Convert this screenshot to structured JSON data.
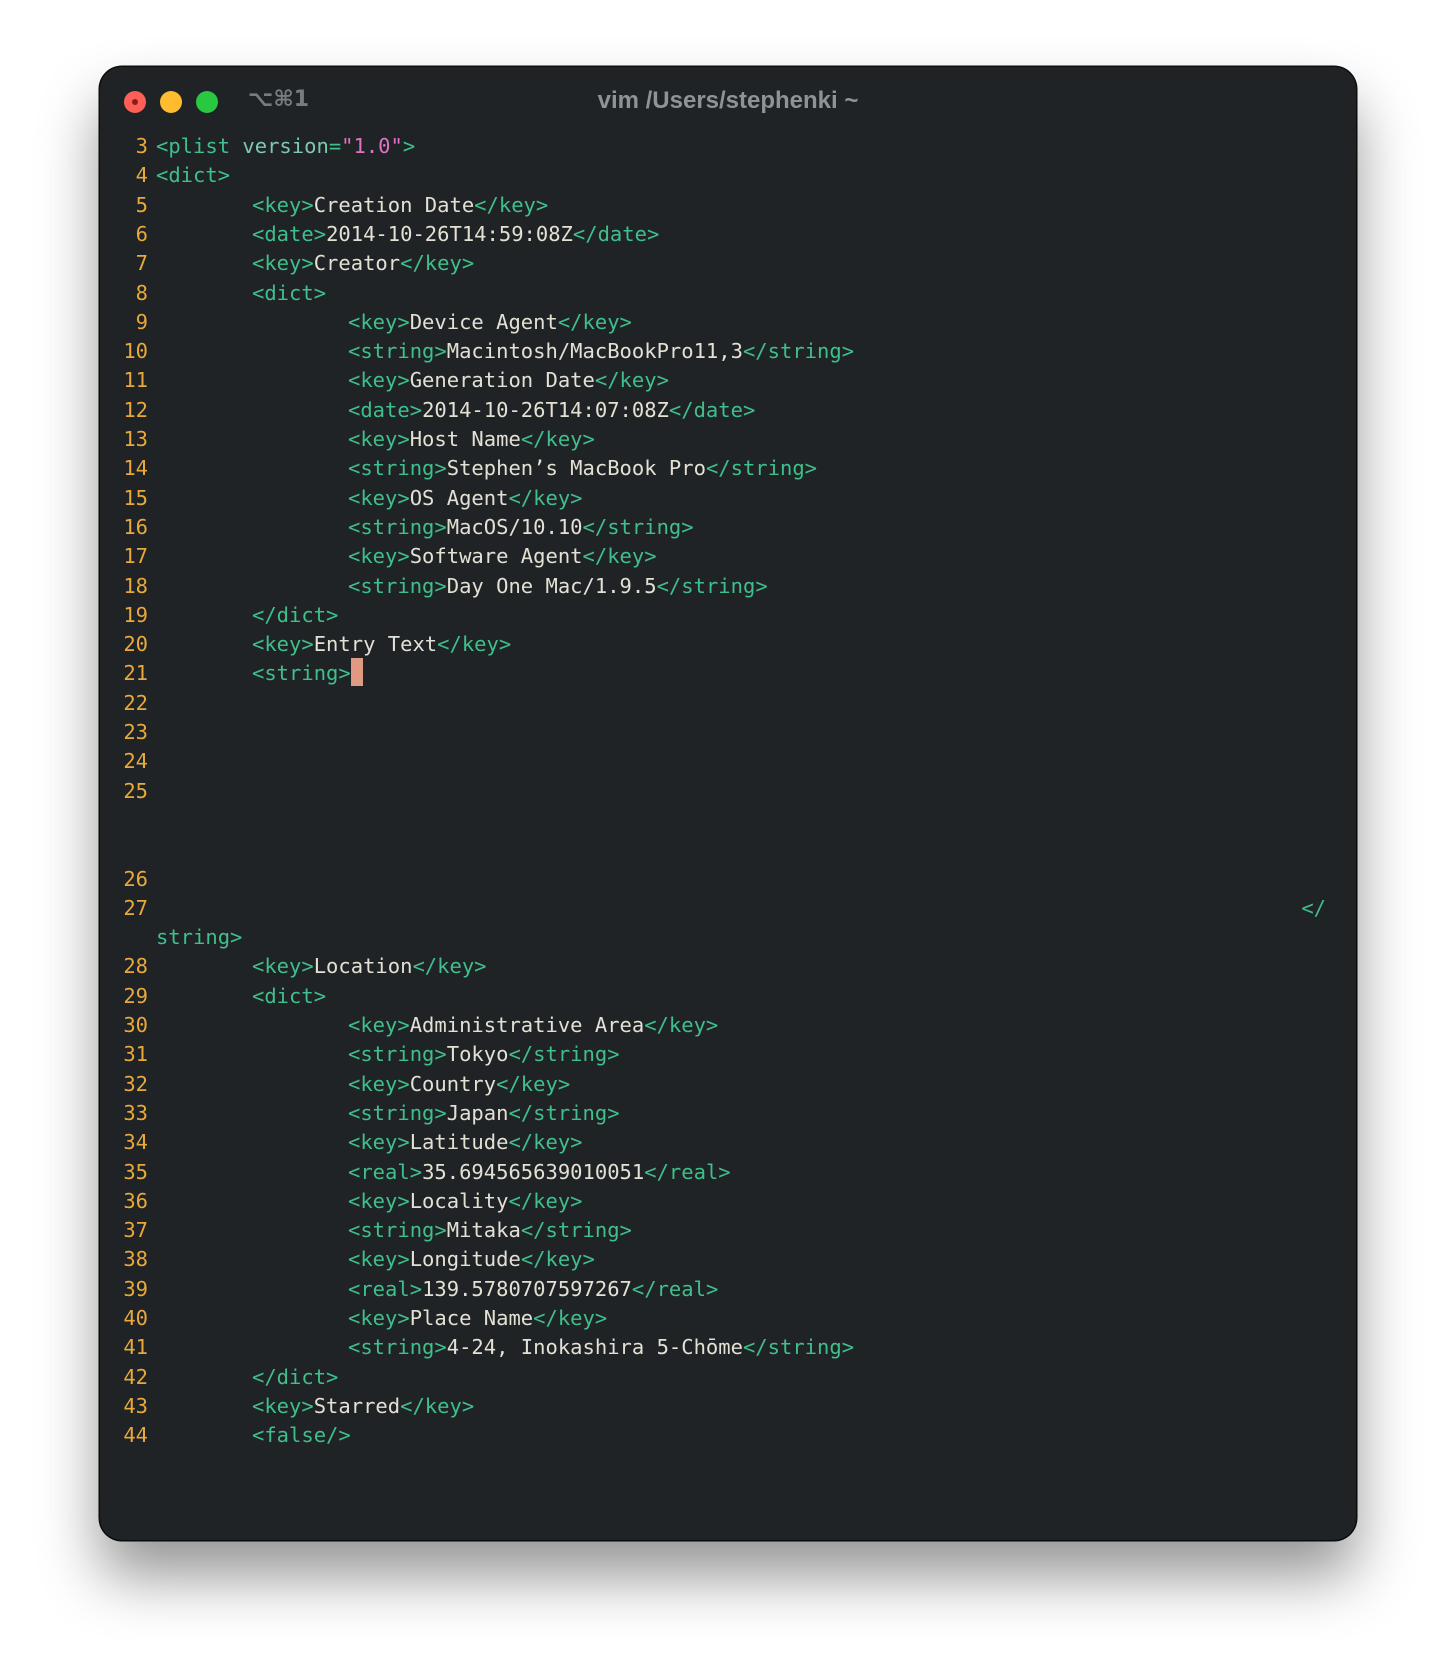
{
  "window": {
    "title": "vim /Users/stephenki ~",
    "tab_shortcut": "⌥⌘1"
  },
  "colors": {
    "background": "#1f2326",
    "line_number": "#e8a93a",
    "tag": "#3fbf8b",
    "attribute": "#7ec8b2",
    "attribute_value": "#e073c4",
    "text": "#e3e0d4",
    "cursor": "#e09a82"
  },
  "lines": [
    {
      "n": "3",
      "indent": 0,
      "parts": [
        [
          "t",
          "<plist "
        ],
        [
          "a",
          "version"
        ],
        [
          "t",
          "="
        ],
        [
          "v",
          "\"1.0\""
        ],
        [
          "t",
          ">"
        ]
      ]
    },
    {
      "n": "4",
      "indent": 0,
      "parts": [
        [
          "t",
          "<dict>"
        ]
      ]
    },
    {
      "n": "5",
      "indent": 1,
      "parts": [
        [
          "t",
          "<key>"
        ],
        [
          "x",
          "Creation Date"
        ],
        [
          "t",
          "</key>"
        ]
      ]
    },
    {
      "n": "6",
      "indent": 1,
      "parts": [
        [
          "t",
          "<date>"
        ],
        [
          "x",
          "2014-10-26T14:59:08Z"
        ],
        [
          "t",
          "</date>"
        ]
      ]
    },
    {
      "n": "7",
      "indent": 1,
      "parts": [
        [
          "t",
          "<key>"
        ],
        [
          "x",
          "Creator"
        ],
        [
          "t",
          "</key>"
        ]
      ]
    },
    {
      "n": "8",
      "indent": 1,
      "parts": [
        [
          "t",
          "<dict>"
        ]
      ]
    },
    {
      "n": "9",
      "indent": 2,
      "parts": [
        [
          "t",
          "<key>"
        ],
        [
          "x",
          "Device Agent"
        ],
        [
          "t",
          "</key>"
        ]
      ]
    },
    {
      "n": "10",
      "indent": 2,
      "parts": [
        [
          "t",
          "<string>"
        ],
        [
          "x",
          "Macintosh/MacBookPro11,3"
        ],
        [
          "t",
          "</string>"
        ]
      ]
    },
    {
      "n": "11",
      "indent": 2,
      "parts": [
        [
          "t",
          "<key>"
        ],
        [
          "x",
          "Generation Date"
        ],
        [
          "t",
          "</key>"
        ]
      ]
    },
    {
      "n": "12",
      "indent": 2,
      "parts": [
        [
          "t",
          "<date>"
        ],
        [
          "x",
          "2014-10-26T14:07:08Z"
        ],
        [
          "t",
          "</date>"
        ]
      ]
    },
    {
      "n": "13",
      "indent": 2,
      "parts": [
        [
          "t",
          "<key>"
        ],
        [
          "x",
          "Host Name"
        ],
        [
          "t",
          "</key>"
        ]
      ]
    },
    {
      "n": "14",
      "indent": 2,
      "parts": [
        [
          "t",
          "<string>"
        ],
        [
          "x",
          "Stephen’s MacBook Pro"
        ],
        [
          "t",
          "</string>"
        ]
      ]
    },
    {
      "n": "15",
      "indent": 2,
      "parts": [
        [
          "t",
          "<key>"
        ],
        [
          "x",
          "OS Agent"
        ],
        [
          "t",
          "</key>"
        ]
      ]
    },
    {
      "n": "16",
      "indent": 2,
      "parts": [
        [
          "t",
          "<string>"
        ],
        [
          "x",
          "MacOS/10.10"
        ],
        [
          "t",
          "</string>"
        ]
      ]
    },
    {
      "n": "17",
      "indent": 2,
      "parts": [
        [
          "t",
          "<key>"
        ],
        [
          "x",
          "Software Agent"
        ],
        [
          "t",
          "</key>"
        ]
      ]
    },
    {
      "n": "18",
      "indent": 2,
      "parts": [
        [
          "t",
          "<string>"
        ],
        [
          "x",
          "Day One Mac/1.9.5"
        ],
        [
          "t",
          "</string>"
        ]
      ]
    },
    {
      "n": "19",
      "indent": 1,
      "parts": [
        [
          "t",
          "</dict>"
        ]
      ]
    },
    {
      "n": "20",
      "indent": 1,
      "parts": [
        [
          "t",
          "<key>"
        ],
        [
          "x",
          "Entry Text"
        ],
        [
          "t",
          "</key>"
        ]
      ]
    },
    {
      "n": "21",
      "indent": 1,
      "parts": [
        [
          "t",
          "<string>"
        ]
      ],
      "cursor": true
    },
    {
      "n": "22",
      "indent": 0,
      "parts": []
    },
    {
      "n": "23",
      "indent": 0,
      "parts": []
    },
    {
      "n": "24",
      "indent": 0,
      "parts": []
    },
    {
      "n": "25",
      "indent": 0,
      "parts": [],
      "extra_rows": 2
    },
    {
      "n": "26",
      "indent": 0,
      "parts": []
    },
    {
      "n": "27",
      "indent": 0,
      "parts": [],
      "wrap_tail": "</",
      "wrap_continuation": "string>"
    },
    {
      "n": "28",
      "indent": 1,
      "parts": [
        [
          "t",
          "<key>"
        ],
        [
          "x",
          "Location"
        ],
        [
          "t",
          "</key>"
        ]
      ]
    },
    {
      "n": "29",
      "indent": 1,
      "parts": [
        [
          "t",
          "<dict>"
        ]
      ]
    },
    {
      "n": "30",
      "indent": 2,
      "parts": [
        [
          "t",
          "<key>"
        ],
        [
          "x",
          "Administrative Area"
        ],
        [
          "t",
          "</key>"
        ]
      ]
    },
    {
      "n": "31",
      "indent": 2,
      "parts": [
        [
          "t",
          "<string>"
        ],
        [
          "x",
          "Tokyo"
        ],
        [
          "t",
          "</string>"
        ]
      ]
    },
    {
      "n": "32",
      "indent": 2,
      "parts": [
        [
          "t",
          "<key>"
        ],
        [
          "x",
          "Country"
        ],
        [
          "t",
          "</key>"
        ]
      ]
    },
    {
      "n": "33",
      "indent": 2,
      "parts": [
        [
          "t",
          "<string>"
        ],
        [
          "x",
          "Japan"
        ],
        [
          "t",
          "</string>"
        ]
      ]
    },
    {
      "n": "34",
      "indent": 2,
      "parts": [
        [
          "t",
          "<key>"
        ],
        [
          "x",
          "Latitude"
        ],
        [
          "t",
          "</key>"
        ]
      ]
    },
    {
      "n": "35",
      "indent": 2,
      "parts": [
        [
          "t",
          "<real>"
        ],
        [
          "x",
          "35.694565639010051"
        ],
        [
          "t",
          "</real>"
        ]
      ]
    },
    {
      "n": "36",
      "indent": 2,
      "parts": [
        [
          "t",
          "<key>"
        ],
        [
          "x",
          "Locality"
        ],
        [
          "t",
          "</key>"
        ]
      ]
    },
    {
      "n": "37",
      "indent": 2,
      "parts": [
        [
          "t",
          "<string>"
        ],
        [
          "x",
          "Mitaka"
        ],
        [
          "t",
          "</string>"
        ]
      ]
    },
    {
      "n": "38",
      "indent": 2,
      "parts": [
        [
          "t",
          "<key>"
        ],
        [
          "x",
          "Longitude"
        ],
        [
          "t",
          "</key>"
        ]
      ]
    },
    {
      "n": "39",
      "indent": 2,
      "parts": [
        [
          "t",
          "<real>"
        ],
        [
          "x",
          "139.5780707597267"
        ],
        [
          "t",
          "</real>"
        ]
      ]
    },
    {
      "n": "40",
      "indent": 2,
      "parts": [
        [
          "t",
          "<key>"
        ],
        [
          "x",
          "Place Name"
        ],
        [
          "t",
          "</key>"
        ]
      ]
    },
    {
      "n": "41",
      "indent": 2,
      "parts": [
        [
          "t",
          "<string>"
        ],
        [
          "x",
          "4-24, Inokashira 5-Chōme"
        ],
        [
          "t",
          "</string>"
        ]
      ]
    },
    {
      "n": "42",
      "indent": 1,
      "parts": [
        [
          "t",
          "</dict>"
        ]
      ]
    },
    {
      "n": "43",
      "indent": 1,
      "parts": [
        [
          "t",
          "<key>"
        ],
        [
          "x",
          "Starred"
        ],
        [
          "t",
          "</key>"
        ]
      ]
    },
    {
      "n": "44",
      "indent": 1,
      "parts": [
        [
          "t",
          "<false/>"
        ]
      ]
    }
  ]
}
